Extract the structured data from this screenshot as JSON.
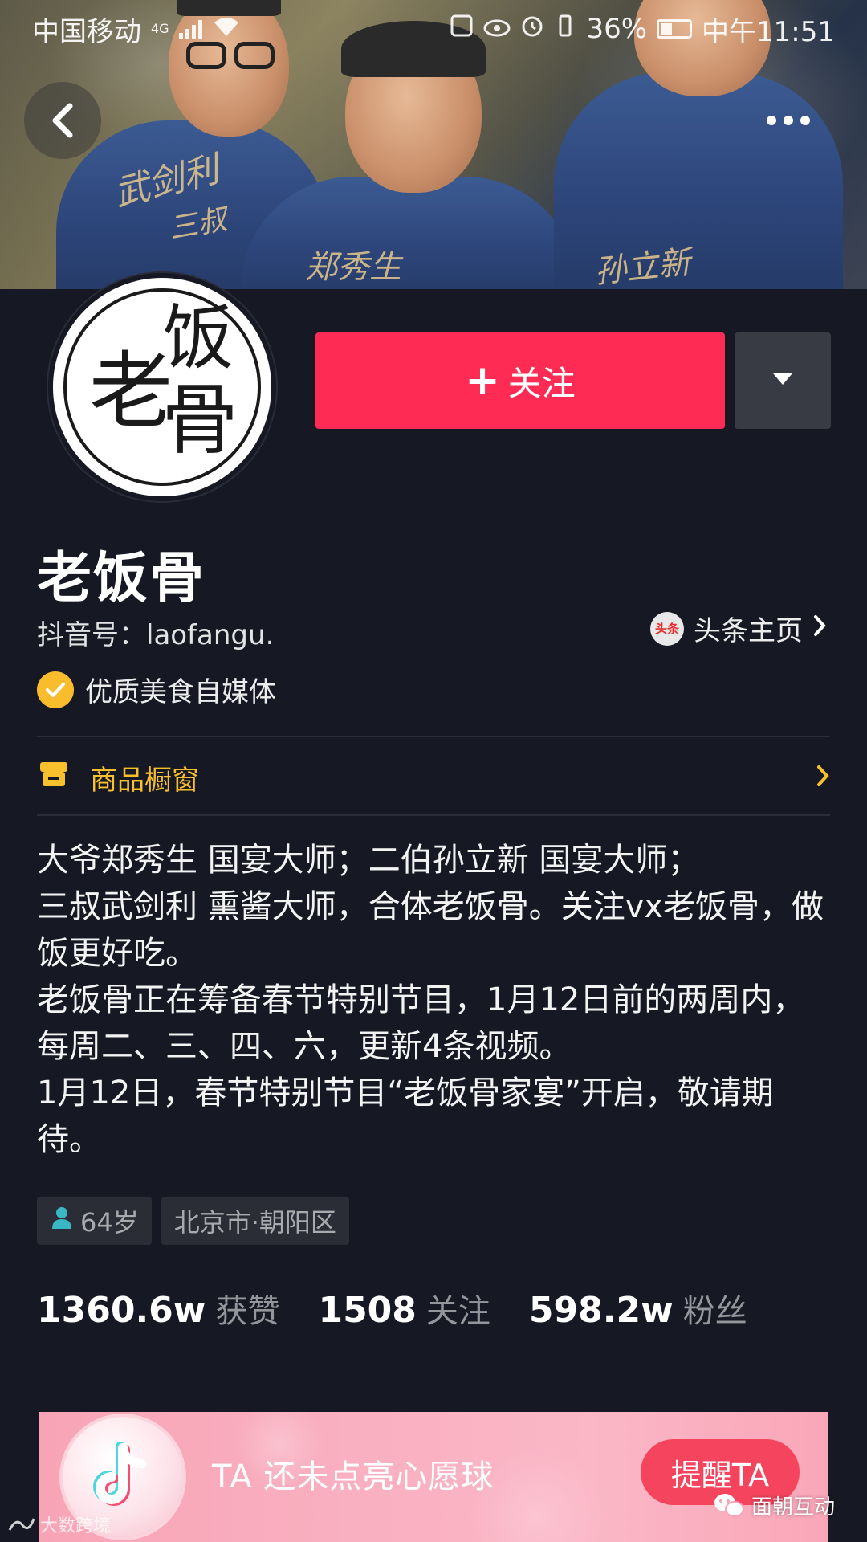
{
  "status_bar": {
    "carrier": "中国移动",
    "network": "4G",
    "battery": "36%",
    "time": "中午11:51"
  },
  "header": {
    "back_icon": "back-arrow-icon",
    "more_icon": "more-dots-icon",
    "signatures": [
      "武剑利",
      "三叔",
      "郑秀生",
      "孙立新"
    ]
  },
  "avatar": {
    "chars": [
      "老",
      "饭",
      "骨"
    ]
  },
  "actions": {
    "follow_plus": "+",
    "follow_label": "关注",
    "dropdown_icon": "caret-down-icon"
  },
  "profile": {
    "name": "老饭骨",
    "douyin_id": "抖音号：laofangu.",
    "toutiao_logo_text": "头条",
    "toutiao_label": "头条主页",
    "verified_label": "优质美食自媒体",
    "shop_label": "商品橱窗",
    "bio": [
      "大爷郑秀生 国宴大师；二伯孙立新 国宴大师；",
      "三叔武剑利 熏酱大师，合体老饭骨。关注vx老饭骨，做饭更好吃。",
      "老饭骨正在筹备春节特别节目，1月12日前的两周内，每周二、三、四、六，更新4条视频。",
      "1月12日，春节特别节目“老饭骨家宴”开启，敬请期待。"
    ],
    "tags": {
      "age": "64岁",
      "location": "北京市·朝阳区"
    }
  },
  "stats": [
    {
      "num": "1360.6w",
      "label": "获赞"
    },
    {
      "num": "1508",
      "label": "关注"
    },
    {
      "num": "598.2w",
      "label": "粉丝"
    }
  ],
  "wish": {
    "text": "TA 还未点亮心愿球",
    "button": "提醒TA"
  },
  "watermarks": {
    "left": "大数跨境",
    "right": "面朝互动"
  },
  "colors": {
    "background": "#161823",
    "accent": "#fe2c55",
    "gold": "#f8c02c"
  }
}
